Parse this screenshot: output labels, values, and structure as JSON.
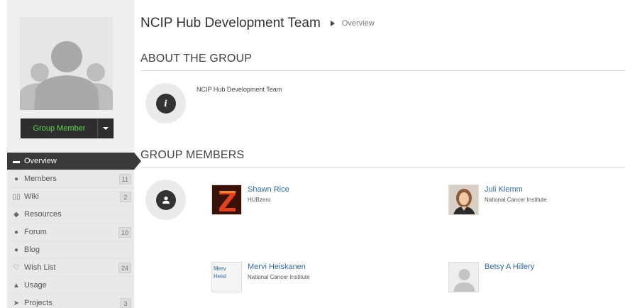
{
  "group": {
    "title": "NCIP Hub Development Team",
    "breadcrumb": "Overview",
    "membership_button": "Group Member"
  },
  "nav": [
    {
      "label": "Overview",
      "icon": "overview-icon",
      "glyph": "▬",
      "count": "",
      "active": true
    },
    {
      "label": "Members",
      "icon": "members-icon",
      "glyph": "●",
      "count": "11"
    },
    {
      "label": "Wiki",
      "icon": "wiki-icon",
      "glyph": "▯▯",
      "count": "2"
    },
    {
      "label": "Resources",
      "icon": "resources-icon",
      "glyph": "◆",
      "count": ""
    },
    {
      "label": "Forum",
      "icon": "forum-icon",
      "glyph": "●",
      "count": "10"
    },
    {
      "label": "Blog",
      "icon": "blog-icon",
      "glyph": "●",
      "count": ""
    },
    {
      "label": "Wish List",
      "icon": "wishlist-icon",
      "glyph": "♡",
      "count": "24"
    },
    {
      "label": "Usage",
      "icon": "usage-icon",
      "glyph": "▲",
      "count": ""
    },
    {
      "label": "Projects",
      "icon": "projects-icon",
      "glyph": "➤",
      "count": "3"
    }
  ],
  "about": {
    "heading": "ABOUT THE GROUP",
    "text": "NCIP Hub Development Team",
    "icon_glyph": "i"
  },
  "members_section": {
    "heading": "GROUP MEMBERS",
    "members": [
      {
        "name": "Shawn Rice",
        "org": "HUBzero"
      },
      {
        "name": "Juli Klemm",
        "org": "National Cancer Institute"
      },
      {
        "name": "Mervi Heiskanen",
        "org": "National Cancer Institute",
        "photo_alt": "Merv Heisl"
      },
      {
        "name": "Betsy A Hillery",
        "org": ""
      }
    ]
  },
  "colors": {
    "active_nav": "#3a3a3a",
    "member_button_text": "#61d64c",
    "link": "#2f6ba3"
  }
}
